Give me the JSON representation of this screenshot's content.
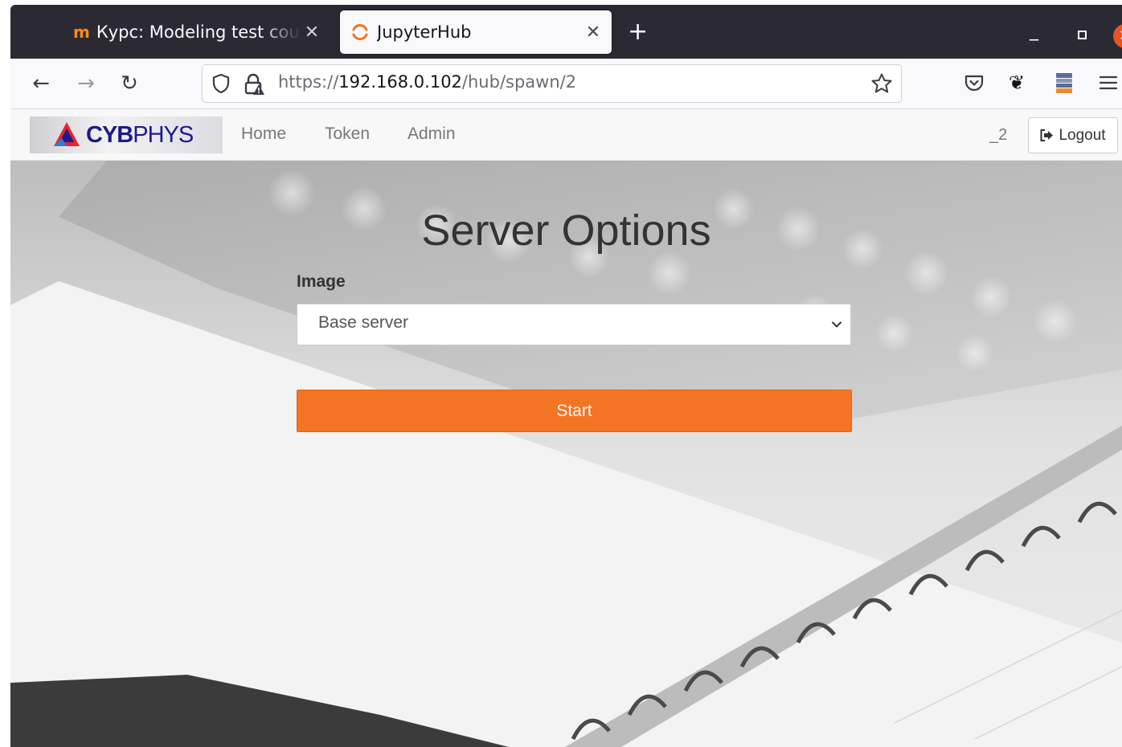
{
  "browser": {
    "tabs": [
      {
        "title": "Курс: Modeling test course",
        "favicon": "moodle-m-icon"
      },
      {
        "title": "JupyterHub",
        "favicon": "jupyter-icon",
        "active": true
      }
    ],
    "address": {
      "scheme": "https://",
      "host": "192.168.0.102",
      "path": "/hub/spawn/2"
    }
  },
  "hub": {
    "brand": {
      "prefix": "CYB",
      "suffix": "PHYS"
    },
    "nav": [
      "Home",
      "Token",
      "Admin"
    ],
    "user": "_2",
    "logout_label": "Logout"
  },
  "spawn": {
    "title": "Server Options",
    "image_label": "Image",
    "image_selected": "Base server",
    "start_label": "Start"
  },
  "colors": {
    "accent": "#f37524",
    "brand": "#1e1a8a",
    "titlebar": "#2b2a33"
  }
}
